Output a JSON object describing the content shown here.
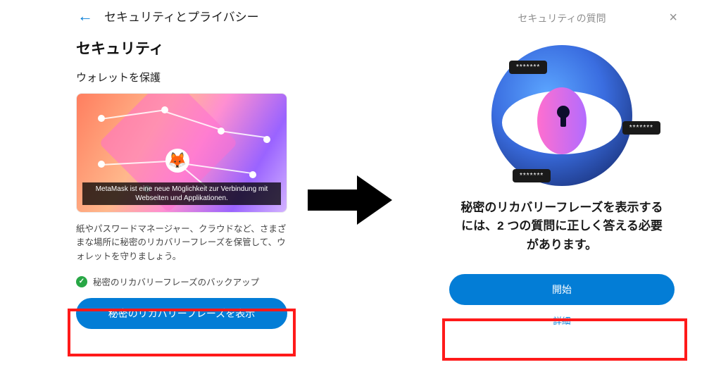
{
  "left": {
    "page_title": "セキュリティとプライバシー",
    "section_title": "セキュリティ",
    "subsection_title": "ウォレットを保護",
    "video_caption": "MetaMask ist eine neue Möglichkeit zur Verbindung mit Webseiten und Applikationen.",
    "description": "紙やパスワードマネージャー、クラウドなど、さまざまな場所に秘密のリカバリーフレーズを保管して、ウォレットを守りましょう。",
    "backup_label": "秘密のリカバリーフレーズのバックアップ",
    "reveal_button": "秘密のリカバリーフレーズを表示"
  },
  "right": {
    "modal_title": "セキュリティの質問",
    "chip1": "*******",
    "chip2": "*******",
    "chip3": "*******",
    "prompt": "秘密のリカバリーフレーズを表示するには、2 つの質問に正しく答える必要があります。",
    "start_button": "開始",
    "detail_link": "詳細"
  }
}
